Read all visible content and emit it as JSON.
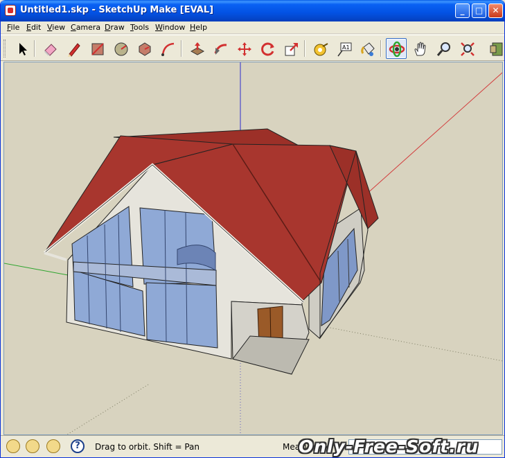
{
  "window": {
    "title": "Untitled1.skp - SketchUp Make [EVAL]",
    "controls": {
      "minimize": "_",
      "maximize": "□",
      "close": "✕"
    }
  },
  "menu": {
    "items": [
      {
        "label": "File",
        "accel": "F",
        "rest": "ile"
      },
      {
        "label": "Edit",
        "accel": "E",
        "rest": "dit"
      },
      {
        "label": "View",
        "accel": "V",
        "rest": "iew"
      },
      {
        "label": "Camera",
        "accel": "C",
        "rest": "amera"
      },
      {
        "label": "Draw",
        "accel": "D",
        "rest": "raw"
      },
      {
        "label": "Tools",
        "accel": "T",
        "rest": "ools"
      },
      {
        "label": "Window",
        "accel": "W",
        "rest": "indow"
      },
      {
        "label": "Help",
        "accel": "H",
        "rest": "elp"
      }
    ]
  },
  "toolbar": {
    "tools": [
      {
        "icon": "select-arrow-icon"
      },
      {
        "icon": "eraser-icon"
      },
      {
        "icon": "pencil-line-icon"
      },
      {
        "icon": "rectangle-icon"
      },
      {
        "icon": "circle-icon"
      },
      {
        "icon": "polygon-icon"
      },
      {
        "icon": "arc-icon"
      },
      {
        "icon": "push-pull-icon"
      },
      {
        "icon": "follow-me-icon"
      },
      {
        "icon": "move-icon"
      },
      {
        "icon": "rotate-icon"
      },
      {
        "icon": "scale-icon"
      },
      {
        "icon": "tape-measure-icon"
      },
      {
        "icon": "text-icon",
        "text": "A1"
      },
      {
        "icon": "paint-bucket-icon"
      },
      {
        "icon": "orbit-icon",
        "active": true
      },
      {
        "icon": "pan-hand-icon"
      },
      {
        "icon": "zoom-icon"
      },
      {
        "icon": "zoom-extents-icon"
      },
      {
        "icon": "components-icon"
      }
    ]
  },
  "status": {
    "hint": "Drag to orbit.  Shift = Pan",
    "measurements_label": "Measurements",
    "measurements_value": "",
    "icons": [
      "geo-location-icon",
      "credits-icon",
      "instructor-icon",
      "help-icon"
    ]
  },
  "watermark": {
    "text": "Only-Free-Soft.ru"
  },
  "colors": {
    "viewport_bg": "#d8d3bf",
    "roof": "#a8362e",
    "glass": "#8fa9d6",
    "wall": "#e6e4dc",
    "axis_red": "#d23c3c",
    "axis_green": "#2fa52f",
    "axis_blue": "#2b2bcf",
    "active_tool_border": "#316ac5"
  }
}
